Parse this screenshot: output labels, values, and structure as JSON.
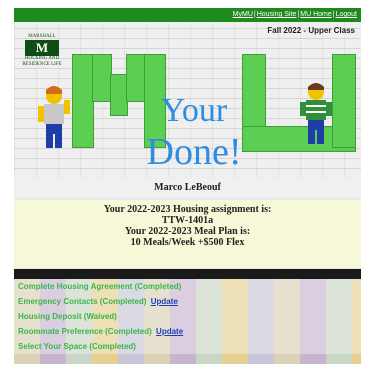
{
  "nav": {
    "links": [
      "MyMU",
      "Housing Site",
      "MU Home",
      "Logout"
    ],
    "sep": "|"
  },
  "hero": {
    "semester": "Fall 2022 - Upper Class",
    "logo_mark": "M",
    "logo_top": "MARSHALL",
    "logo_bottom": "HOUSING AND RESIDENCE LIFE",
    "headline_1": "Your",
    "headline_2": "Done!"
  },
  "student_name": "Marco LeBeouf",
  "assignment": {
    "line1": "Your 2022-2023 Housing assignment is:",
    "room": "TTW-1401a",
    "line3": "Your 2022-2023 Meal Plan is:",
    "meal_plan": "10 Meals/Week +$500 Flex"
  },
  "checklist": [
    {
      "label": "Complete Housing Agreement (Completed)",
      "link": ""
    },
    {
      "label": "Emergency Contacts (Completed)",
      "link": "Update"
    },
    {
      "label": "Housing Deposit (Waived)",
      "link": ""
    },
    {
      "label": "Roommate Preference (Completed)",
      "link": "Update"
    },
    {
      "label": "Select Your Space (Completed)",
      "link": ""
    }
  ],
  "colors": {
    "nav_green": "#1e8a1e",
    "brick_green": "#5ccf52",
    "headline_blue": "#2f8de0",
    "checklist_green": "#3bb54a",
    "link_blue": "#1d3fb8"
  }
}
